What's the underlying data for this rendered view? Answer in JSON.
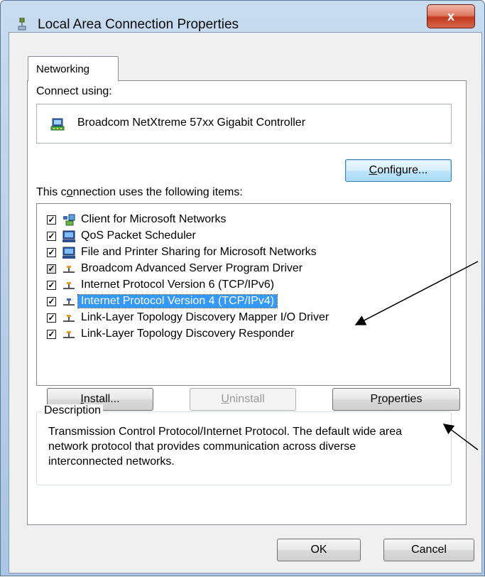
{
  "window": {
    "title": "Local Area Connection Properties",
    "close_glyph": "x"
  },
  "tabs": [
    {
      "label": "Networking"
    }
  ],
  "connect_using": {
    "label": "Connect using:",
    "adapter": "Broadcom NetXtreme 57xx Gigabit Controller"
  },
  "configure_button": {
    "pre": "",
    "key": "C",
    "post": "onfigure..."
  },
  "items_label": {
    "pre": "This c",
    "key": "o",
    "post": "nnection uses the following items:"
  },
  "items": [
    {
      "label": "Client for Microsoft Networks",
      "checked": true,
      "icon": "network-client-icon"
    },
    {
      "label": "QoS Packet Scheduler",
      "checked": true,
      "icon": "computer-service-icon"
    },
    {
      "label": "File and Printer Sharing for Microsoft Networks",
      "checked": true,
      "icon": "computer-service-icon"
    },
    {
      "label": "Broadcom Advanced Server Program Driver",
      "checked": true,
      "icon": "protocol-icon"
    },
    {
      "label": "Internet Protocol Version 6 (TCP/IPv6)",
      "checked": true,
      "icon": "protocol-icon"
    },
    {
      "label": "Internet Protocol Version 4 (TCP/IPv4)",
      "checked": true,
      "icon": "protocol-icon",
      "selected": true
    },
    {
      "label": "Link-Layer Topology Discovery Mapper I/O Driver",
      "checked": true,
      "icon": "protocol-icon"
    },
    {
      "label": "Link-Layer Topology Discovery Responder",
      "checked": true,
      "icon": "protocol-icon"
    }
  ],
  "buttons": {
    "install": {
      "pre": "",
      "key": "I",
      "post": "nstall..."
    },
    "uninstall": {
      "pre": "",
      "key": "U",
      "post": "ninstall"
    },
    "properties": {
      "pre": "P",
      "key": "r",
      "post": "operties"
    },
    "ok": "OK",
    "cancel": "Cancel"
  },
  "description": {
    "legend": "Description",
    "text": "Transmission Control Protocol/Internet Protocol. The default wide area network protocol that provides communication across diverse interconnected networks."
  },
  "colors": {
    "selection": "#3399ff",
    "title_bar": "#b9d1ea",
    "close_button": "#c4391e",
    "annotation_arrow": "#000000"
  }
}
